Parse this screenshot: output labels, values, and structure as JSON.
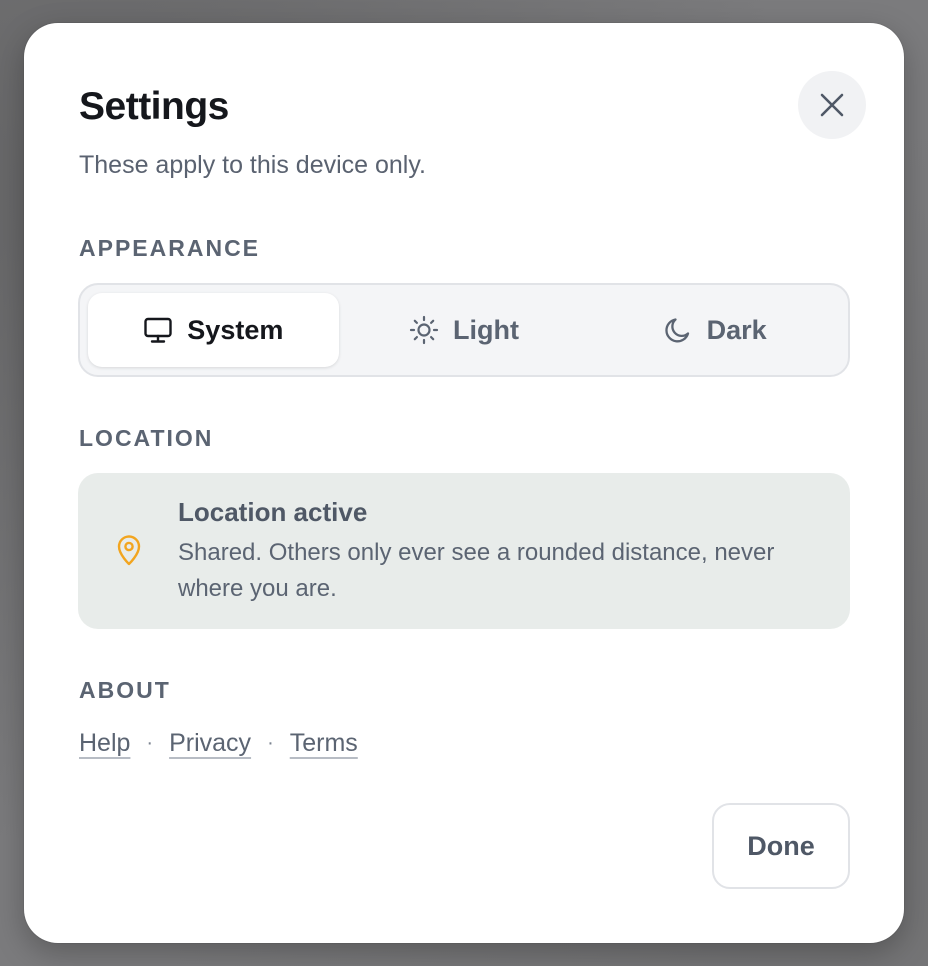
{
  "dialog": {
    "title": "Settings",
    "subtitle": "These apply to this device only."
  },
  "appearance": {
    "label": "APPEARANCE",
    "options": [
      {
        "label": "System",
        "icon": "monitor-icon",
        "selected": true
      },
      {
        "label": "Light",
        "icon": "sun-icon",
        "selected": false
      },
      {
        "label": "Dark",
        "icon": "moon-icon",
        "selected": false
      }
    ]
  },
  "location": {
    "label": "LOCATION",
    "title": "Location active",
    "description": "Shared. Others only ever see a rounded distance, never where you are.",
    "icon": "map-pin-icon",
    "icon_color": "#f2a51f"
  },
  "about": {
    "label": "ABOUT",
    "links": [
      "Help",
      "Privacy",
      "Terms"
    ],
    "separator": "·"
  },
  "footer": {
    "done_label": "Done"
  },
  "icons": {
    "close": "close-icon"
  }
}
